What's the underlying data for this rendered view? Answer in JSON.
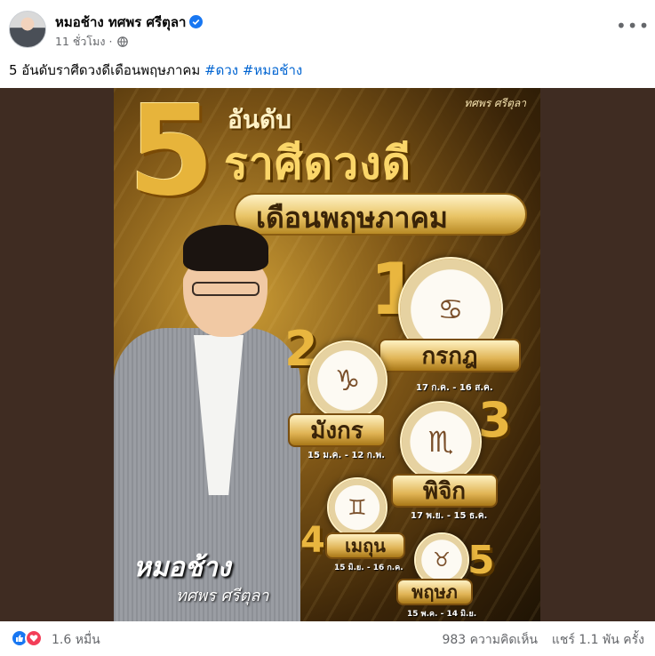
{
  "post": {
    "author": "หมอช้าง ทศพร ศรีตุลา",
    "verified_icon": "verified-badge-icon",
    "time": "11 ชั่วโมง",
    "separator": "·",
    "audience_icon": "globe-icon",
    "more_label": "•••",
    "caption_text": "5 อันดับราศีดวงดีเดือนพฤษภาคม",
    "hashtags": [
      "#ดวง",
      "#หมอช้าง"
    ]
  },
  "poster": {
    "signature": "ทศพร ศรีตุลา",
    "big_number": "5",
    "title_small": "อันดับ",
    "title_main": "ราศีดวงดี",
    "subtitle": "เดือนพฤษภาคม",
    "brand_name": "หมอช้าง",
    "brand_sub": "ทศพร ศรีตุลา",
    "rankings": [
      {
        "rank": "1",
        "sign": "กรกฎ",
        "dates": "17 ก.ค. - 16 ส.ค.",
        "icon": "crab-icon"
      },
      {
        "rank": "2",
        "sign": "มังกร",
        "dates": "15 ม.ค. - 12 ก.พ.",
        "icon": "goat-icon"
      },
      {
        "rank": "3",
        "sign": "พิจิก",
        "dates": "17 พ.ย. - 15 ธ.ค.",
        "icon": "scorpion-icon"
      },
      {
        "rank": "4",
        "sign": "เมถุน",
        "dates": "15 มิ.ย. - 16 ก.ค.",
        "icon": "twins-icon"
      },
      {
        "rank": "5",
        "sign": "พฤษภ",
        "dates": "15 พ.ค. - 14 มิ.ย.",
        "icon": "bull-icon"
      }
    ]
  },
  "footer": {
    "reaction_icons": [
      "like-icon",
      "love-icon"
    ],
    "reaction_count": "1.6 หมื่น",
    "comments": "983 ความคิดเห็น",
    "shares": "แชร์ 1.1 พัน ครั้ง"
  },
  "colors": {
    "link": "#0064d1",
    "like": "#1877f2",
    "love": "#f33e58",
    "gold": "#e7b43b"
  }
}
